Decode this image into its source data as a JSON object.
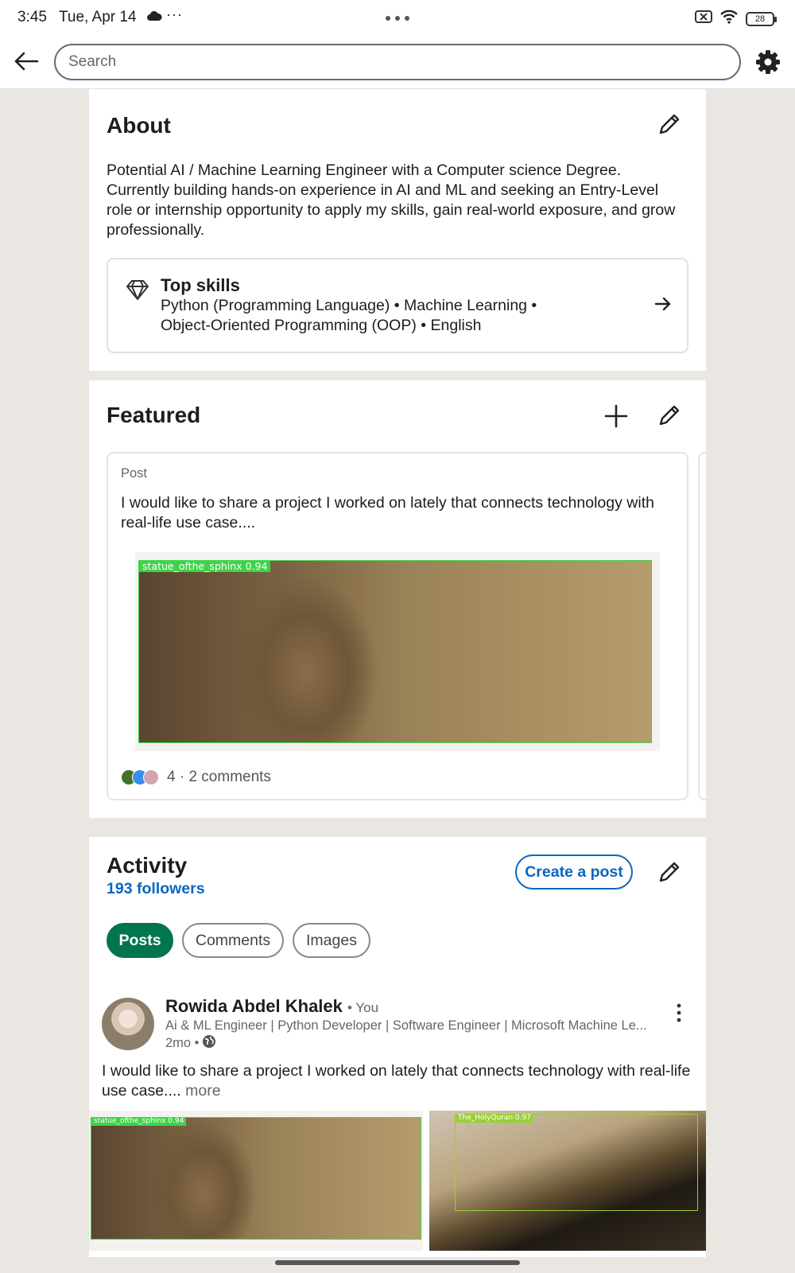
{
  "status_bar": {
    "time": "3:45",
    "date": "Tue, Apr 14",
    "overflow": "···",
    "battery": "28"
  },
  "app_bar": {
    "search_placeholder": "Search"
  },
  "about": {
    "title": "About",
    "text": "Potential AI / Machine Learning Engineer with a Computer science Degree. Currently building hands-on experience in AI and ML and seeking an Entry-Level role or  internship opportunity to apply my skills, gain real-world exposure, and grow professionally.",
    "top_skills": {
      "title": "Top skills",
      "skills_line1": "Python (Programming Language) • Machine Learning •",
      "skills_line2": "Object-Oriented Programming (OOP) • English"
    }
  },
  "featured": {
    "title": "Featured",
    "post": {
      "label": "Post",
      "text": "I would like to share a project I worked on lately that connects technology with real-life use case....",
      "detection_label": "statue_ofthe_sphinx  0.94",
      "reactions_text": "4 · 2 comments"
    }
  },
  "activity": {
    "title": "Activity",
    "followers": "193 followers",
    "create_post": "Create a post",
    "tabs": [
      {
        "label": "Posts",
        "active": true
      },
      {
        "label": "Comments",
        "active": false
      },
      {
        "label": "Images",
        "active": false
      }
    ],
    "post": {
      "author": "Rowida Abdel Khalek",
      "you_tag": "• You",
      "headline": "Ai & ML Engineer | Python Developer | Software Engineer | Microsoft Machine Le...",
      "time": "2mo •",
      "text": "I would like to share a project I worked on lately that connects technology with real-life use case....",
      "more": "more",
      "image1_label": "statue_ofthe_sphinx  0.94",
      "image2_label": "The_HolyQuran  0.97"
    }
  },
  "colors": {
    "accent_blue": "#0a66c2",
    "active_green": "#01754f",
    "detection_green": "#3fd34a",
    "background": "#eae7e2"
  }
}
